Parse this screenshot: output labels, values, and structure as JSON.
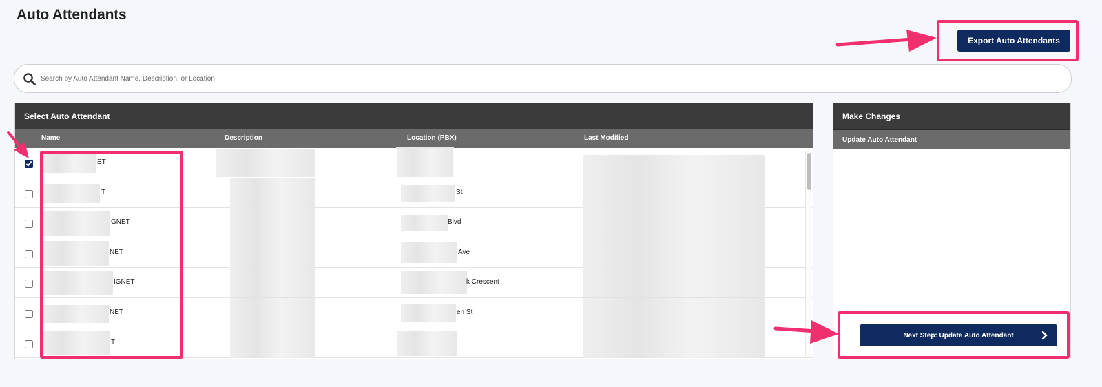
{
  "page": {
    "title": "Auto Attendants"
  },
  "toolbar": {
    "export_label": "Export Auto Attendants"
  },
  "search": {
    "placeholder": "Search by Auto Attendant Name, Description, or Location"
  },
  "left_panel": {
    "title": "Select Auto Attendant",
    "columns": [
      "Name",
      "Description",
      "Location (PBX)",
      "Last Modified"
    ],
    "rows": [
      {
        "checked": true,
        "name_tail": "ET",
        "location_tail": ""
      },
      {
        "checked": false,
        "name_tail": "T",
        "location_tail": "St"
      },
      {
        "checked": false,
        "name_tail": "GNET",
        "location_tail": "Blvd"
      },
      {
        "checked": false,
        "name_tail": "NET",
        "location_tail": "Ave"
      },
      {
        "checked": false,
        "name_tail": "IGNET",
        "location_tail": "k Crescent"
      },
      {
        "checked": false,
        "name_tail": "NET",
        "location_tail": "en St"
      },
      {
        "checked": false,
        "name_tail": "T",
        "location_tail": ""
      }
    ]
  },
  "right_panel": {
    "title": "Make Changes",
    "subtitle": "Update Auto Attendant",
    "next_label": "Next Step: Update Auto Attendant"
  },
  "colors": {
    "primary": "#0f2a5e",
    "highlight": "#f0306e",
    "header_dark": "#3b3b3b",
    "header_mid": "#6b6b6b"
  },
  "icons": {
    "search": "search-icon",
    "next": "chevron-right-icon"
  }
}
